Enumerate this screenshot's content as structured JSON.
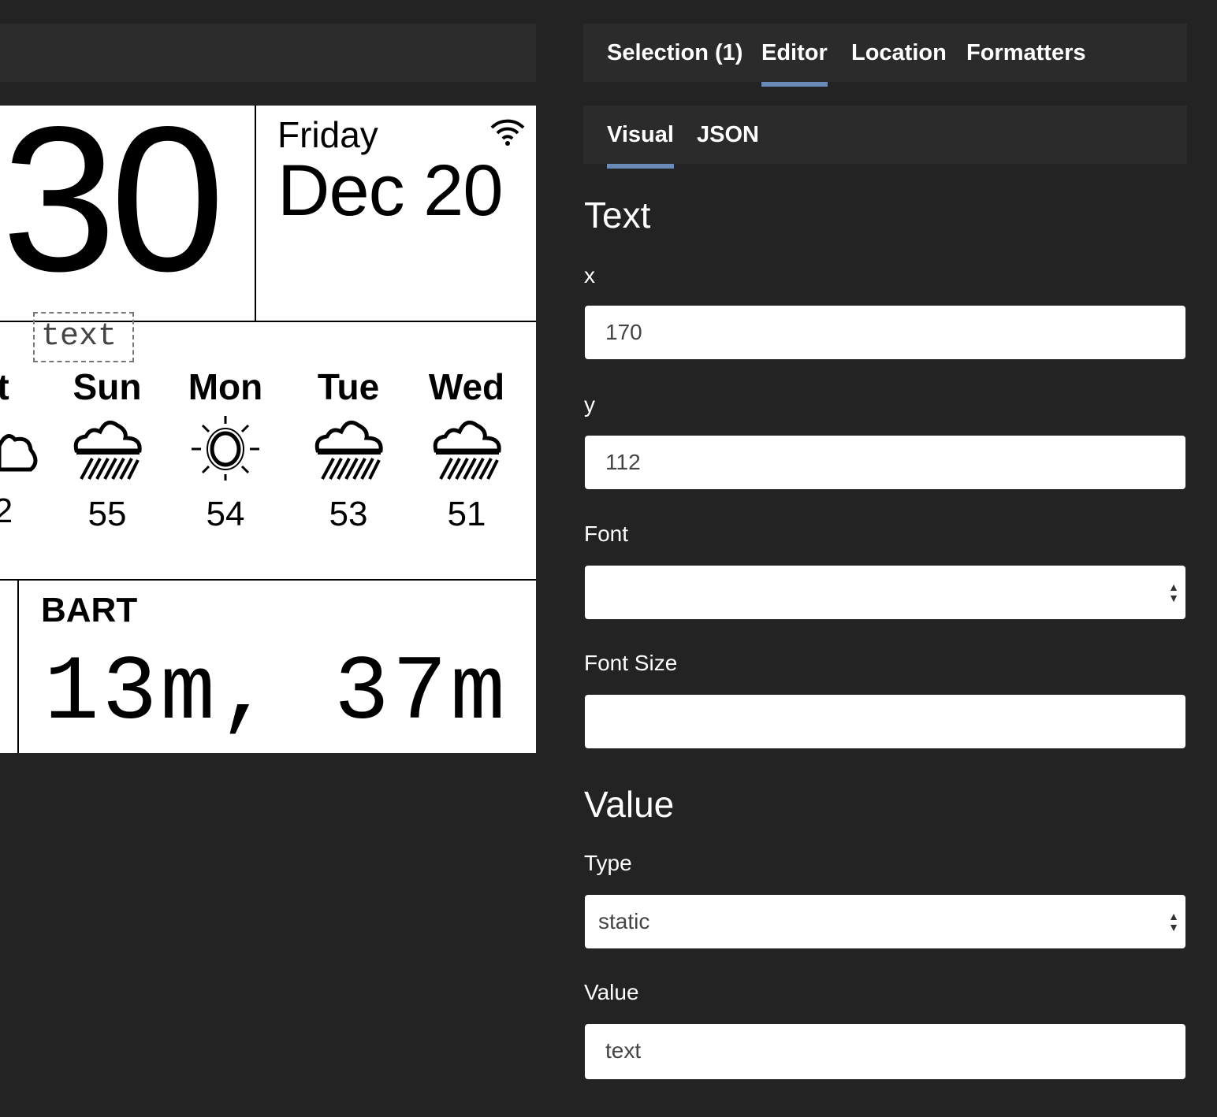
{
  "canvas": {
    "hour_digits": "30",
    "weekday": "Friday",
    "date": "Dec 20",
    "selected_text": "text",
    "forecast": [
      {
        "day": "t",
        "icon": "partly-cloudy-icon",
        "temp": "2"
      },
      {
        "day": "Sun",
        "icon": "rain-icon",
        "temp": "55"
      },
      {
        "day": "Mon",
        "icon": "sun-icon",
        "temp": "54"
      },
      {
        "day": "Tue",
        "icon": "rain-icon",
        "temp": "53"
      },
      {
        "day": "Wed",
        "icon": "rain-icon",
        "temp": "51"
      }
    ],
    "bart_label": "BART",
    "bart_times": "13m, 37m"
  },
  "tabs": [
    {
      "label": "Selection (1)",
      "active": false
    },
    {
      "label": "Editor",
      "active": true
    },
    {
      "label": "Location",
      "active": false
    },
    {
      "label": "Formatters",
      "active": false
    }
  ],
  "subtabs": [
    {
      "label": "Visual",
      "active": true
    },
    {
      "label": "JSON",
      "active": false
    }
  ],
  "editor": {
    "text_heading": "Text",
    "x_label": "x",
    "x_value": "170",
    "y_label": "y",
    "y_value": "112",
    "font_label": "Font",
    "font_value": "",
    "font_size_label": "Font Size",
    "font_size_value": "",
    "value_heading": "Value",
    "type_label": "Type",
    "type_value": "static",
    "value_label": "Value",
    "value_value": "text"
  },
  "colors": {
    "background": "#232323",
    "panel": "#2b2b2b",
    "accent": "#6a8bb8"
  }
}
